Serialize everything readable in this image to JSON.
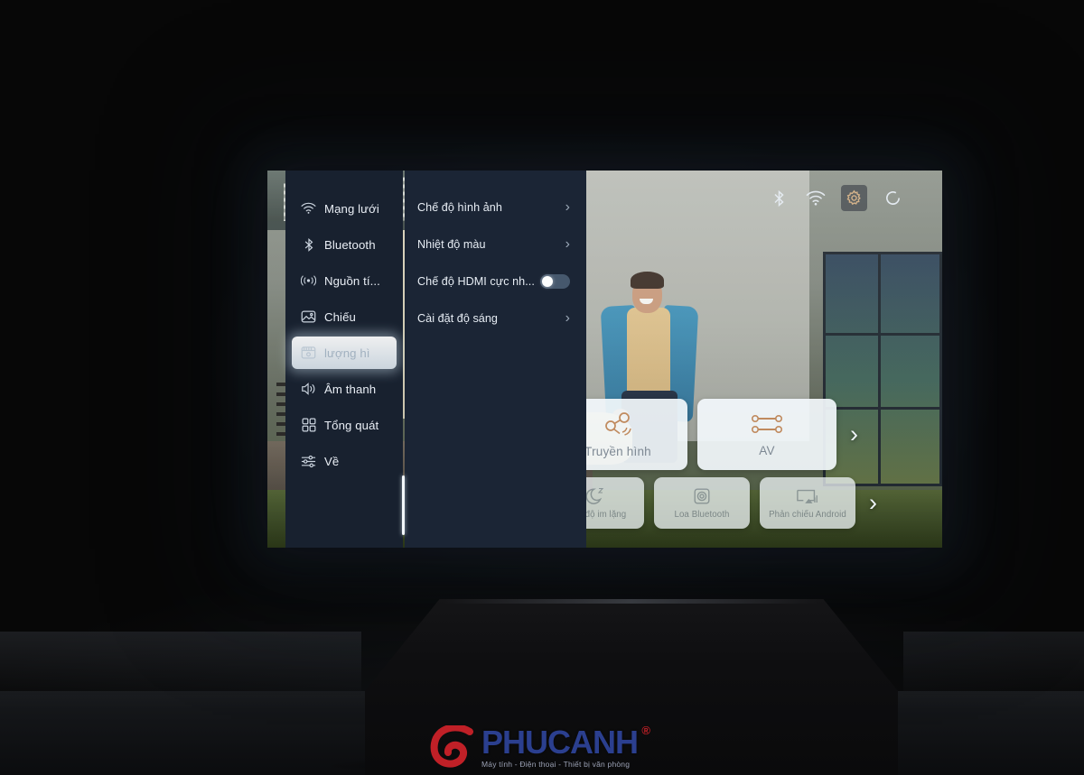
{
  "scene": {
    "device": "projector",
    "description": "Projector casting a settings menu onto a wall in a dark room"
  },
  "status_bar": {
    "icons": [
      {
        "name": "bluetooth-icon",
        "label": "Bluetooth",
        "active": false
      },
      {
        "name": "wifi-icon",
        "label": "Wi-Fi",
        "active": false
      },
      {
        "name": "gear-icon",
        "label": "Cài đặt",
        "active": true
      },
      {
        "name": "circle-icon",
        "label": "Nguồn",
        "active": false
      }
    ]
  },
  "settings": {
    "sidebar": {
      "items": [
        {
          "label": "Mạng lưới",
          "icon": "wifi-icon",
          "selected": false
        },
        {
          "label": "Bluetooth",
          "icon": "bluetooth-icon",
          "selected": false
        },
        {
          "label": "Nguồn tí...",
          "icon": "broadcast-icon",
          "selected": false
        },
        {
          "label": "Chiếu",
          "icon": "image-icon",
          "selected": false
        },
        {
          "label": "lượng hì",
          "icon": "video-icon",
          "selected": true
        },
        {
          "label": "Âm thanh",
          "icon": "speaker-icon",
          "selected": false
        },
        {
          "label": "Tổng quát",
          "icon": "grid-icon",
          "selected": false
        },
        {
          "label": "Về",
          "icon": "sliders-icon",
          "selected": false
        }
      ]
    },
    "panel": {
      "items": [
        {
          "label": "Chế độ hình ảnh",
          "control": "chevron"
        },
        {
          "label": "Nhiệt độ màu",
          "control": "chevron"
        },
        {
          "label": "Chế độ HDMI cực nh...",
          "control": "toggle",
          "toggle_on": false
        },
        {
          "label": "Cài đặt độ sáng",
          "control": "chevron"
        }
      ]
    }
  },
  "home": {
    "row1": [
      {
        "label": "Truyền hình",
        "icon": "antenna-icon"
      },
      {
        "label": "AV",
        "icon": "av-connector-icon"
      }
    ],
    "row1_next": "›",
    "row2": [
      {
        "label": "Chế độ im lặng",
        "icon": "moon-sleep-icon"
      },
      {
        "label": "Loa Bluetooth",
        "icon": "bluetooth-speaker-icon"
      },
      {
        "label": "Phản chiếu Android",
        "icon": "screen-cast-icon"
      }
    ],
    "row2_next": "›"
  },
  "watermark": {
    "brand_prefix": "PHUC",
    "brand_suffix": "ANH",
    "registered": "®",
    "tagline": "Máy tính  -  Điện thoại  -  Thiết bị văn phòng"
  },
  "colors": {
    "sidebar_bg": "#18212f",
    "panel_bg": "#1b2535",
    "accent_text": "#e9eef5",
    "selected_bg": "#ffffff",
    "card_bg": "#f3f8fc",
    "brand_red": "#c02027",
    "brand_blue": "#2b3f8f",
    "gear_accent": "#d8b48a"
  }
}
